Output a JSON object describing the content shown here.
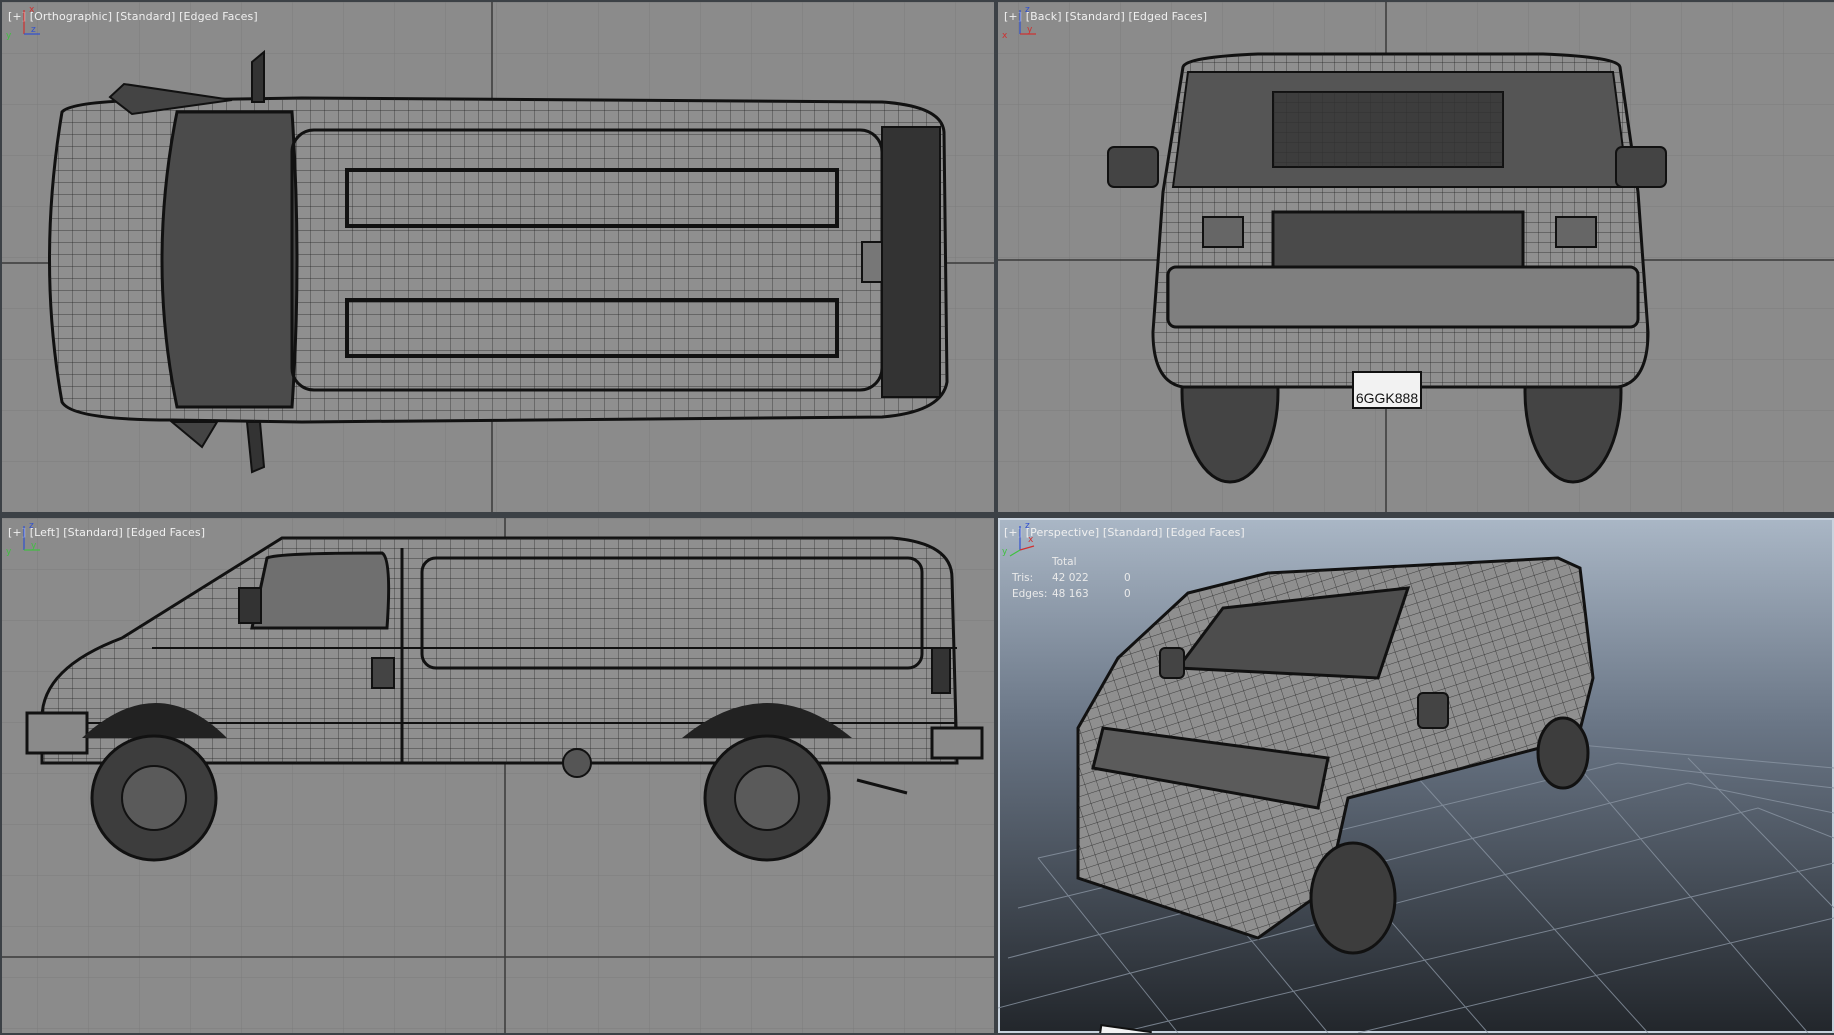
{
  "viewports": [
    {
      "id": "top",
      "labels": [
        "[+]",
        "[Orthographic]",
        "[Standard]",
        "[Edged Faces]"
      ],
      "axes": {
        "up": "x",
        "right": "z",
        "origin": "y"
      }
    },
    {
      "id": "back",
      "labels": [
        "[+]",
        "[Back]",
        "[Standard]",
        "[Edged Faces]"
      ],
      "axes": {
        "up": "z",
        "right": "y",
        "origin": "x"
      }
    },
    {
      "id": "left",
      "labels": [
        "[+]",
        "[Left]",
        "[Standard]",
        "[Edged Faces]"
      ],
      "axes": {
        "up": "z",
        "right": "y",
        "origin": "y"
      }
    },
    {
      "id": "persp",
      "labels": [
        "[+]",
        "[Perspective]",
        "[Standard]",
        "[Edged Faces]"
      ],
      "axes": {
        "up": "z",
        "right": "x",
        "origin": "y"
      }
    }
  ],
  "stats": {
    "header": "Total",
    "rows": [
      {
        "label": "Tris:",
        "total": "42 022",
        "selected": "0"
      },
      {
        "label": "Edges:",
        "total": "48 163",
        "selected": "0"
      }
    ]
  },
  "license_plate": "6GGK888",
  "colors": {
    "viewport_bg": "#8b8b8b",
    "grid": "#7d7d7d",
    "grid_axis": "#3a3a3a",
    "wire": "#1a1a1a",
    "van": "#8f8f8f",
    "persp_top": "#aab7c6",
    "persp_bottom": "#22262b",
    "frame": "#3c4146"
  }
}
